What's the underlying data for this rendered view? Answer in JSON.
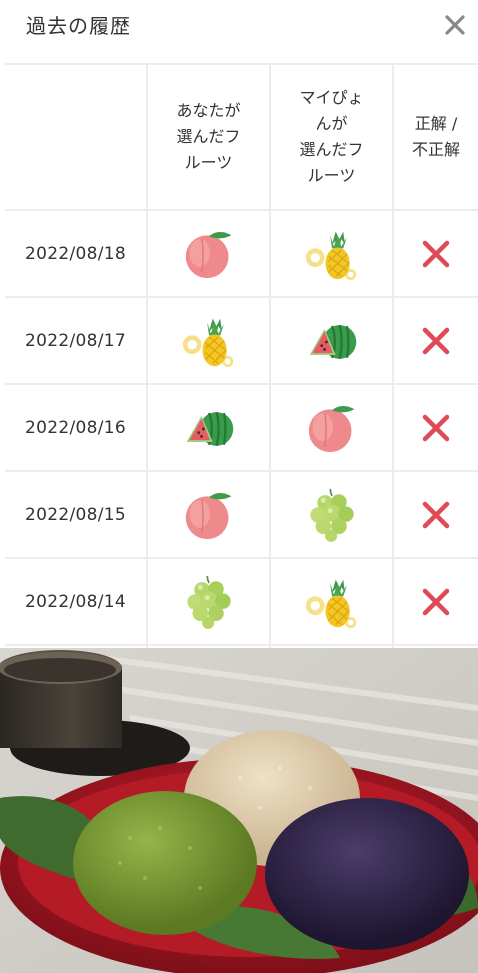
{
  "header": {
    "title": "過去の履歴",
    "close_icon": "close-icon"
  },
  "table": {
    "columns": [
      "",
      "あなたが\n選んだフ\nルーツ",
      "マイぴょ\nんが\n選んだフ\nルーツ",
      "正解 /\n不正解"
    ],
    "rows": [
      {
        "date": "2022/08/18",
        "yours": "peach",
        "mypyon": "pineapple",
        "result": "incorrect"
      },
      {
        "date": "2022/08/17",
        "yours": "pineapple",
        "mypyon": "watermelon",
        "result": "incorrect"
      },
      {
        "date": "2022/08/16",
        "yours": "watermelon",
        "mypyon": "peach",
        "result": "incorrect"
      },
      {
        "date": "2022/08/15",
        "yours": "peach",
        "mypyon": "grapes",
        "result": "incorrect"
      },
      {
        "date": "2022/08/14",
        "yours": "grapes",
        "mypyon": "pineapple",
        "result": "incorrect"
      }
    ]
  },
  "colors": {
    "incorrect_mark": "#e04a57",
    "border": "#ececec",
    "text": "#333333"
  },
  "photo": {
    "subject": "dango-mochi-plate"
  }
}
